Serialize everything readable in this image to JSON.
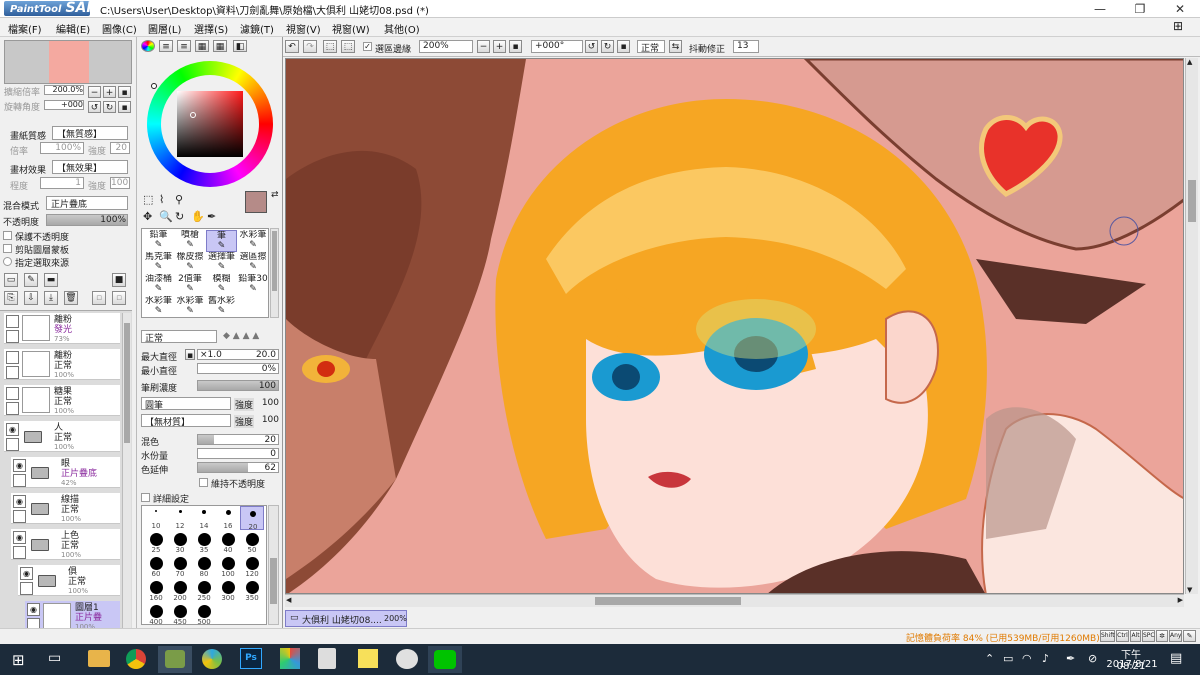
{
  "window": {
    "title": "C:\\Users\\User\\Desktop\\資料\\刀劍亂舞\\原始檔\\大俱利 山姥切08.psd (*)",
    "logo_small": "PaintTool",
    "logo_big": "SAI",
    "minimize": "—",
    "maximize": "❐",
    "close": "✕"
  },
  "menu": [
    "檔案(F)",
    "編輯(E)",
    "圖像(C)",
    "圖層(L)",
    "選擇(S)",
    "濾鏡(T)",
    "視窗(V)",
    "視窗(W)",
    "其他(O)"
  ],
  "navigator": {
    "zoom_label": "擴縮倍率",
    "zoom_value": "200.0%",
    "rotate_label": "旋轉角度",
    "rotate_value": "+000"
  },
  "paper": {
    "texture_label": "畫紙質感",
    "texture_value": "【無質感】",
    "scale_label": "倍率",
    "scale_value": "100%",
    "strength_label": "強度",
    "strength_value": "20",
    "effect_label": "畫材效果",
    "effect_value": "【無效果】",
    "width_label": "程度",
    "width_value": "1",
    "intensity_label": "強度",
    "intensity_value": "100"
  },
  "blend": {
    "mode_label": "混合模式",
    "mode_value": "正片疊底",
    "opacity_label": "不透明度",
    "opacity_value": "100%",
    "opacity_fraction": 1.0,
    "preserve_label": "保護不透明度",
    "clip_label": "剪貼圖層蒙板",
    "source_label": "指定選取來源"
  },
  "layers": [
    {
      "name": "離粉",
      "mode": "發光",
      "opacity": "73%",
      "type": "layer",
      "mode_color": "#8a2a9e",
      "indent": 0
    },
    {
      "name": "離粉",
      "mode": "正常",
      "opacity": "100%",
      "type": "layer",
      "mode_color": "#222222",
      "indent": 0
    },
    {
      "name": "糖果",
      "mode": "正常",
      "opacity": "100%",
      "type": "layer",
      "mode_color": "#222222",
      "indent": 0
    },
    {
      "name": "人",
      "mode": "正常",
      "opacity": "100%",
      "type": "folder",
      "mode_color": "#222222",
      "indent": 0
    },
    {
      "name": "眼",
      "mode": "正片疊底",
      "opacity": "42%",
      "type": "folder",
      "mode_color": "#8a2a9e",
      "indent": 1
    },
    {
      "name": "線描",
      "mode": "正常",
      "opacity": "100%",
      "type": "folder",
      "mode_color": "#222222",
      "indent": 1
    },
    {
      "name": "上色",
      "mode": "正常",
      "opacity": "100%",
      "type": "folder",
      "mode_color": "#222222",
      "indent": 1
    },
    {
      "name": "俱",
      "mode": "正常",
      "opacity": "100%",
      "type": "folder",
      "mode_color": "#222222",
      "indent": 2
    },
    {
      "name": "圖層1",
      "mode": "正片疊",
      "opacity": "100%",
      "type": "layer",
      "mode_color": "#8a2a9e",
      "indent": 3
    }
  ],
  "tools": [
    "鉛筆",
    "噴槍",
    "筆",
    "水彩筆",
    "馬克筆",
    "橡皮擦",
    "選擇筆",
    "選區擦",
    "油漆桶",
    "2值筆",
    "模糊",
    "鉛筆30",
    "水彩筆",
    "水彩筆",
    "舊水彩",
    ""
  ],
  "brush": {
    "mode_value": "正常",
    "max_size_label": "最大直徑",
    "max_size_mult": "×1.0",
    "max_size_value": "20.0",
    "min_size_label": "最小直徑",
    "min_size_value": "0%",
    "density_label": "筆刷濃度",
    "density_value": "100",
    "density_fraction": 1.0,
    "shape_value": "圓筆",
    "shape_strength_label": "強度",
    "shape_strength_value": "100",
    "texture_value": "【無材質】",
    "texture_strength_label": "強度",
    "texture_strength_value": "100",
    "blend_label": "混色",
    "blend_value": "20",
    "blend_fraction": 0.2,
    "water_label": "水份量",
    "water_value": "0",
    "water_fraction": 0.0,
    "stretch_label": "色延伸",
    "stretch_value": "62",
    "stretch_fraction": 0.62,
    "keep_opacity_label": "維持不透明度",
    "detail_label": "詳細設定",
    "sizes_row1": [
      "10",
      "12",
      "14",
      "16",
      "20"
    ],
    "sizes_row2": [
      "25",
      "30",
      "35",
      "40",
      "50"
    ],
    "sizes_row3": [
      "60",
      "70",
      "80",
      "100",
      "120"
    ],
    "sizes_row4": [
      "160",
      "200",
      "250",
      "300",
      "350"
    ],
    "sizes_row5": [
      "400",
      "450",
      "500"
    ]
  },
  "canvas_toolbar": {
    "selection_edge_label": "選區邊緣",
    "zoom_value": "200%",
    "angle_value": "+000°",
    "mode_value": "正常",
    "stabilizer_label": "抖動修正",
    "stabilizer_value": "13"
  },
  "doc_tab": {
    "name": "大俱利 山姥切08....",
    "zoom": "200%"
  },
  "status": {
    "memory": "記憶體負荷率 84% (已用539MB/可用1260MB)",
    "keys": [
      "Shift",
      "Ctrl",
      "Alt",
      "SPC",
      "Any"
    ]
  },
  "taskbar": {
    "time": "下午 08:21",
    "date": "2017/8/21"
  },
  "colors": {
    "canvas_bg": "#eba49a",
    "accent_blue": "#3b7dd8",
    "layer_highlight": "#c9c7f5"
  }
}
